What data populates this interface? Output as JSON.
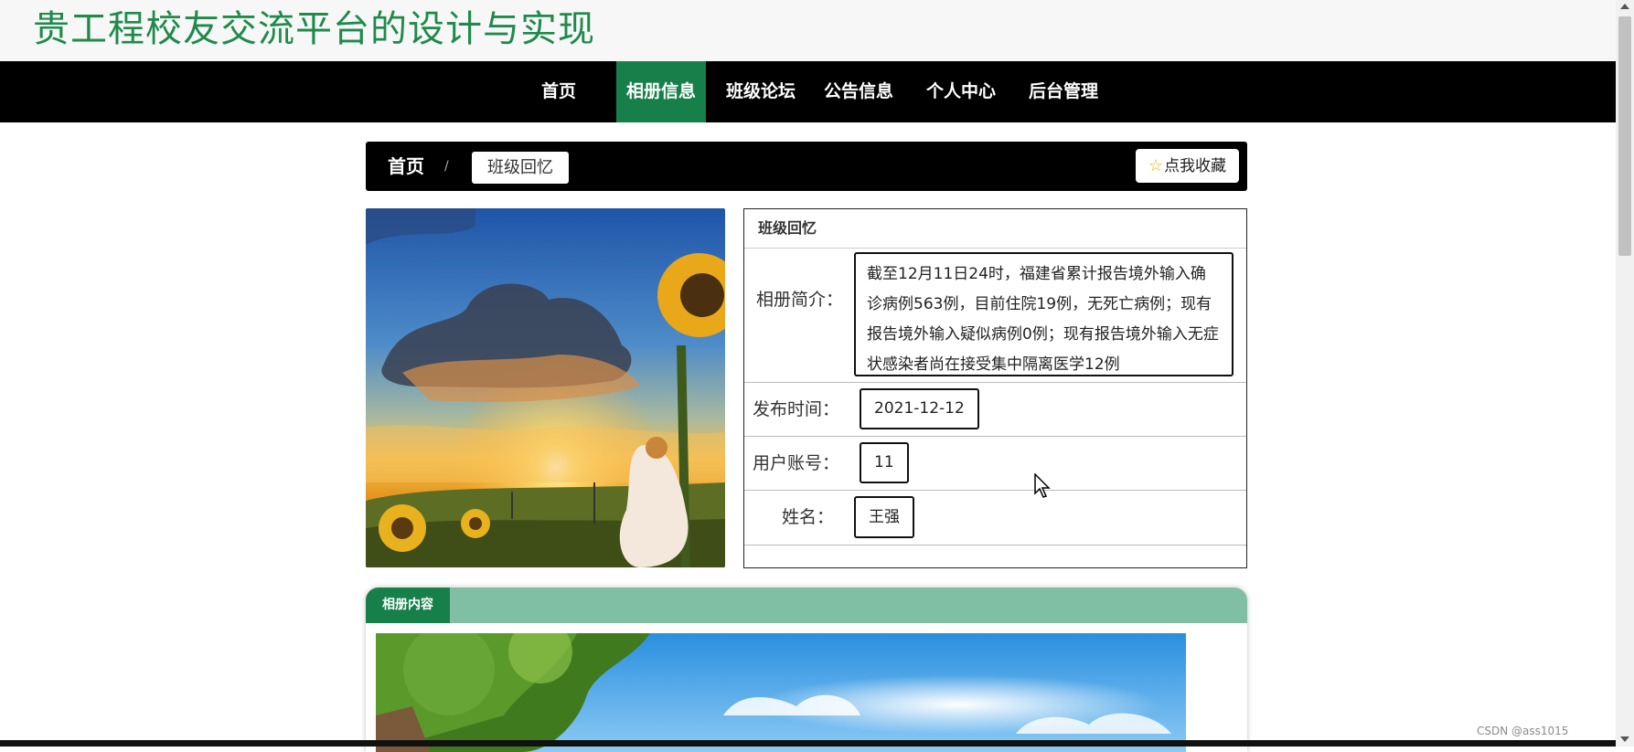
{
  "site": {
    "title": "贵工程校友交流平台的设计与实现"
  },
  "nav": {
    "items": [
      {
        "label": "首页"
      },
      {
        "label": "相册信息"
      },
      {
        "label": "班级论坛"
      },
      {
        "label": "公告信息"
      },
      {
        "label": "个人中心"
      },
      {
        "label": "后台管理"
      }
    ],
    "active_index": 1
  },
  "breadcrumb": {
    "home": "首页",
    "separator": "/",
    "current": "班级回忆"
  },
  "favorite": {
    "icon": "star-outline-icon",
    "label": "点我收藏"
  },
  "detail": {
    "title": "班级回忆",
    "fields": [
      {
        "label": "相册简介：",
        "value": "截至12月11日24时，福建省累计报告境外输入确诊病例563例，目前住院19例，无死亡病例；现有报告境外输入疑似病例0例；现有报告境外输入无症状感染者尚在接受集中隔离医学12例"
      },
      {
        "label": "发布时间：",
        "value": "2021-12-12"
      },
      {
        "label": "用户账号：",
        "value": "11"
      },
      {
        "label": "姓名：",
        "value": "王强"
      }
    ]
  },
  "content": {
    "tab_label": "相册内容"
  },
  "watermark": "CSDN @ass1015",
  "colors": {
    "brand_green": "#17804a",
    "title_green": "#1f8a4c",
    "tab_bar": "#80bfa3",
    "nav_bg": "#000000"
  }
}
